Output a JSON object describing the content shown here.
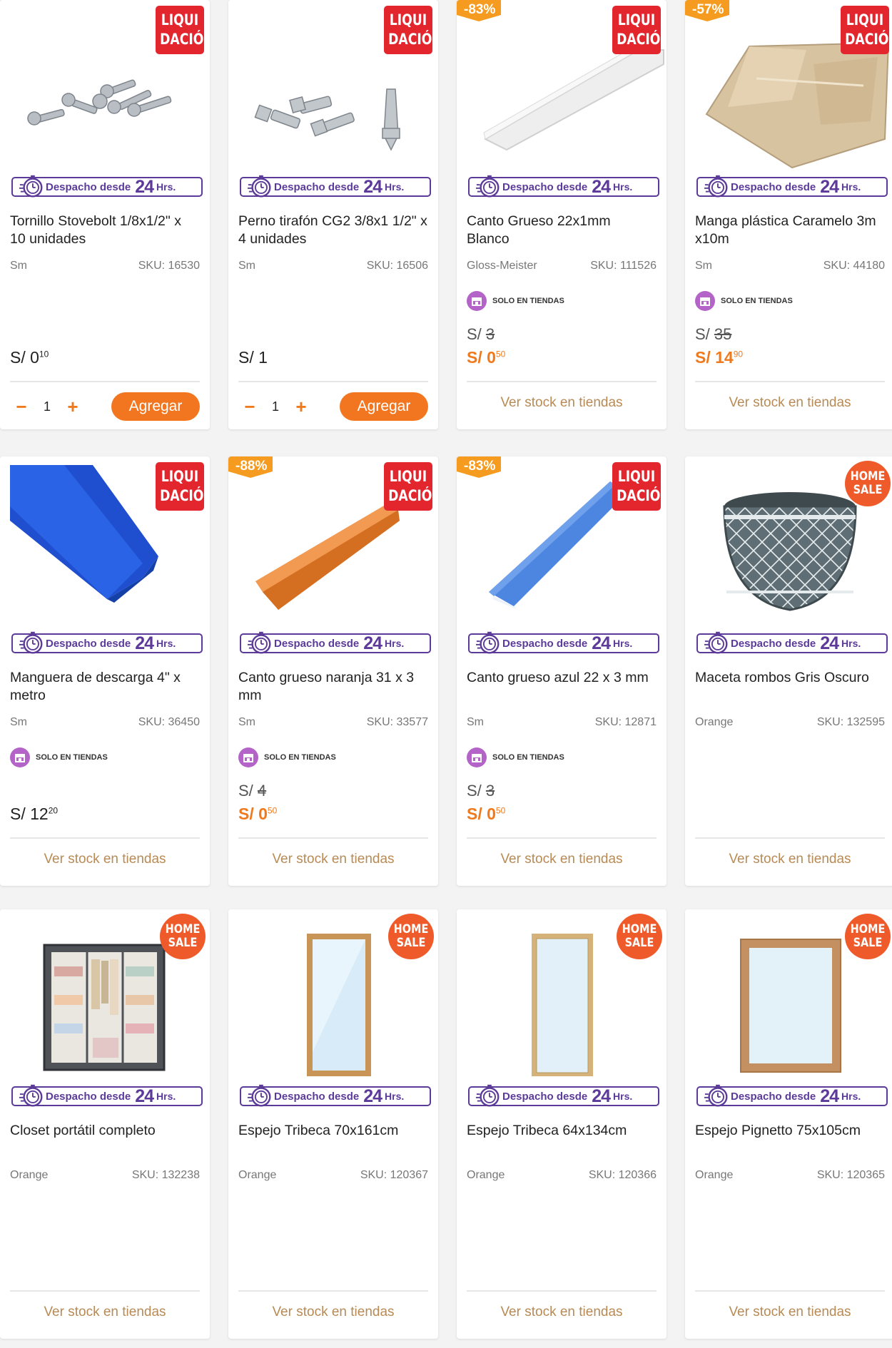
{
  "despacho": {
    "label": "Despacho desde",
    "num": "24",
    "hrs": "Hrs."
  },
  "badges": {
    "liq_top": "LIQUI",
    "liq_bottom": "DACIÓN",
    "home_top": "HOME",
    "home_bottom": "SALE"
  },
  "solo_label": "SOLO EN TIENDAS",
  "stock_label": "Ver stock en tiendas",
  "add_label": "Agregar",
  "qty_minus": "−",
  "qty_plus": "+",
  "colors": {
    "accent": "#f2761f",
    "liquidacion": "#e3262e",
    "despacho": "#5b3a9a",
    "solo": "#b463c9",
    "home_sale": "#ef5a2a",
    "discount": "#f59b1f"
  },
  "products": [
    {
      "name": "Tornillo Stovebolt 1/8x1/2\" x 10 unidades",
      "brand": "Sm",
      "sku": "SKU: 16530",
      "price_int": "S/ 0",
      "price_dec": "10",
      "badge": "liq",
      "discount": "",
      "old_price": "",
      "solo": false,
      "action": "add",
      "qty": "1",
      "image": "screws"
    },
    {
      "name": "Perno tirafón CG2 3/8x1 1/2\" x 4 unidades",
      "brand": "Sm",
      "sku": "SKU: 16506",
      "price_int": "S/ 1",
      "price_dec": "",
      "badge": "liq",
      "discount": "",
      "old_price": "",
      "solo": false,
      "action": "add",
      "qty": "1",
      "image": "bolts"
    },
    {
      "name": "Canto Grueso 22x1mm Blanco",
      "brand": "Gloss-Meister",
      "sku": "SKU: 111526",
      "price_int": "S/ 0",
      "price_dec": "50",
      "badge": "liq",
      "discount": "-83%",
      "old_price_prefix": "S/ ",
      "old_price": "3",
      "solo": true,
      "action": "stock",
      "image": "edge-white"
    },
    {
      "name": "Manga plástica Caramelo 3m x10m",
      "brand": "Sm",
      "sku": "SKU: 44180",
      "price_int": "S/ 14",
      "price_dec": "90",
      "badge": "liq",
      "discount": "-57%",
      "old_price_prefix": "S/ ",
      "old_price": "35",
      "solo": true,
      "action": "stock",
      "image": "plastic"
    },
    {
      "name": "Manguera de descarga 4\" x metro",
      "brand": "Sm",
      "sku": "SKU: 36450",
      "price_int": "S/ 12",
      "price_dec": "20",
      "badge": "liq",
      "discount": "",
      "old_price": "",
      "solo": true,
      "action": "stock",
      "image": "hose"
    },
    {
      "name": "Canto grueso naranja 31 x 3 mm",
      "brand": "Sm",
      "sku": "SKU: 33577",
      "price_int": "S/ 0",
      "price_dec": "50",
      "badge": "liq",
      "discount": "-88%",
      "old_price_prefix": "S/ ",
      "old_price": "4",
      "solo": true,
      "action": "stock",
      "image": "edge-orange"
    },
    {
      "name": "Canto grueso azul 22 x 3 mm",
      "brand": "Sm",
      "sku": "SKU: 12871",
      "price_int": "S/ 0",
      "price_dec": "50",
      "badge": "liq",
      "discount": "-83%",
      "old_price_prefix": "S/ ",
      "old_price": "3",
      "solo": true,
      "action": "stock",
      "image": "edge-blue"
    },
    {
      "name": "Maceta rombos Gris Oscuro",
      "brand": "Orange",
      "sku": "SKU: 132595",
      "price_int": "",
      "price_dec": "",
      "badge": "home",
      "discount": "",
      "old_price": "",
      "solo": false,
      "action": "stock",
      "image": "pot"
    },
    {
      "name": "Closet portátil completo",
      "brand": "Orange",
      "sku": "SKU: 132238",
      "price_int": "",
      "price_dec": "",
      "badge": "home",
      "discount": "",
      "old_price": "",
      "solo": false,
      "action": "stock",
      "image": "closet"
    },
    {
      "name": "Espejo Tribeca 70x161cm",
      "brand": "Orange",
      "sku": "SKU: 120367",
      "price_int": "",
      "price_dec": "",
      "badge": "home",
      "discount": "",
      "old_price": "",
      "solo": false,
      "action": "stock",
      "image": "mirror-tall"
    },
    {
      "name": "Espejo Tribeca 64x134cm",
      "brand": "Orange",
      "sku": "SKU: 120366",
      "price_int": "",
      "price_dec": "",
      "badge": "home",
      "discount": "",
      "old_price": "",
      "solo": false,
      "action": "stock",
      "image": "mirror-narrow"
    },
    {
      "name": "Espejo Pignetto 75x105cm",
      "brand": "Orange",
      "sku": "SKU: 120365",
      "price_int": "",
      "price_dec": "",
      "badge": "home",
      "discount": "",
      "old_price": "",
      "solo": false,
      "action": "stock",
      "image": "mirror-wide"
    }
  ]
}
